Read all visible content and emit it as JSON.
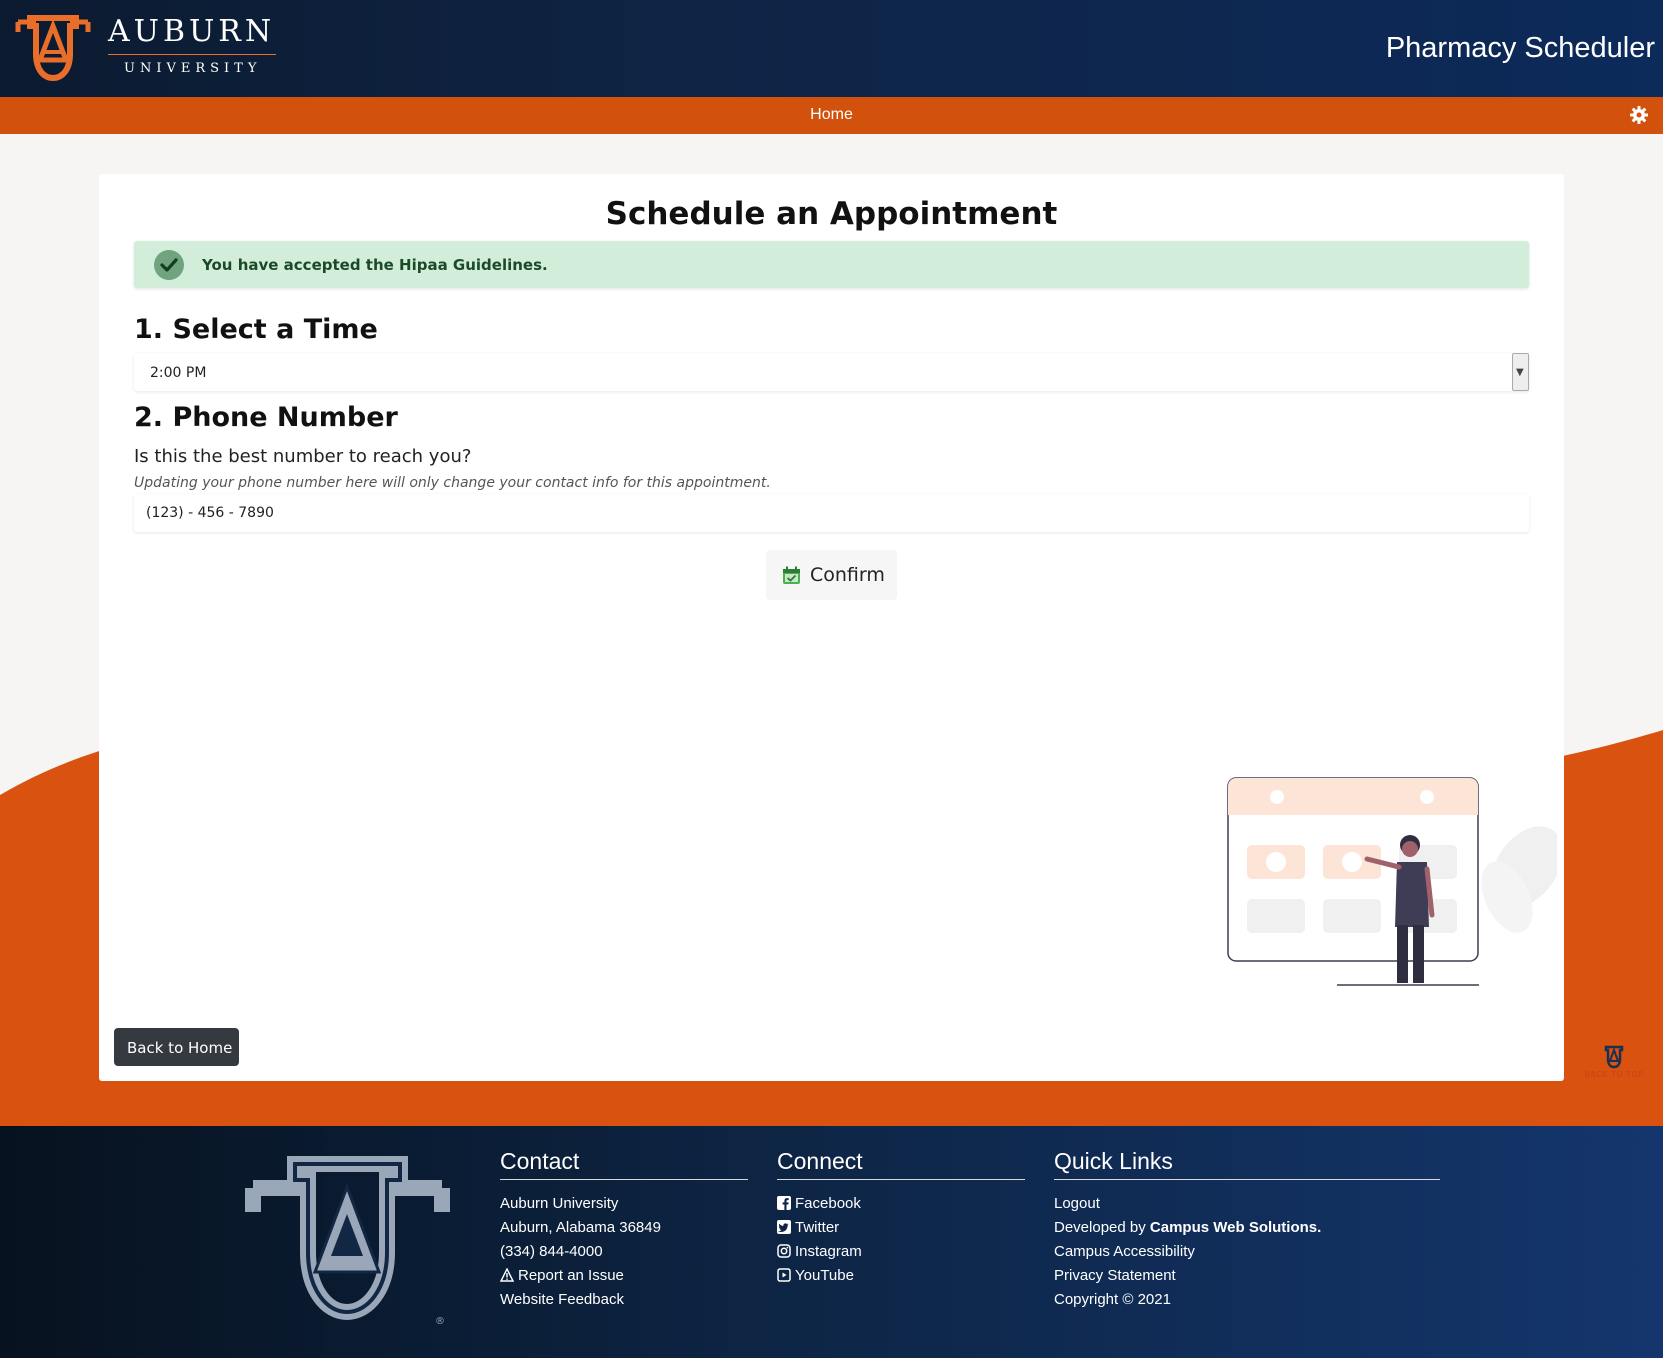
{
  "header": {
    "university_name": "AUBURN",
    "university_sub": "UNIVERSITY",
    "app_title": "Pharmacy Scheduler",
    "logo_icon": "auburn-au-logo-icon"
  },
  "nav": {
    "home_label": "Home",
    "settings_icon": "gear-icon"
  },
  "main": {
    "title": "Schedule an Appointment",
    "alert": {
      "text": "You have accepted the Hipaa Guidelines.",
      "icon": "check-circle-icon",
      "color": "#d3eddb"
    },
    "step1": {
      "heading": "1. Select a Time",
      "selected_value": "2:00 PM"
    },
    "step2": {
      "heading": "2. Phone Number",
      "question": "Is this the best number to reach you?",
      "hint": "Updating your phone number here will only change your contact info for this appointment.",
      "phone_value": "(123) - 456 - 7890"
    },
    "confirm": {
      "label": "Confirm",
      "icon": "calendar-check-icon"
    },
    "back_button_label": "Back to Home",
    "back_to_top_label": "BACK TO TOP"
  },
  "footer": {
    "contact": {
      "heading": "Contact",
      "items": [
        "Auburn University",
        "Auburn, Alabama 36849",
        "(334) 844-4000",
        "Report an Issue",
        "Website Feedback"
      ]
    },
    "connect": {
      "heading": "Connect",
      "items": [
        "Facebook",
        "Twitter",
        "Instagram",
        "YouTube"
      ]
    },
    "quick_links": {
      "heading": "Quick Links",
      "logout": "Logout",
      "developed_prefix": "Developed by",
      "developed_by": "Campus Web Solutions.",
      "accessibility": "Campus Accessibility",
      "privacy": "Privacy Statement",
      "copyright": "Copyright © 2021"
    }
  },
  "colors": {
    "navy": "#0f2444",
    "orange": "#d2520d",
    "success_bg": "#d3eddb",
    "dark_button": "#343a40"
  }
}
